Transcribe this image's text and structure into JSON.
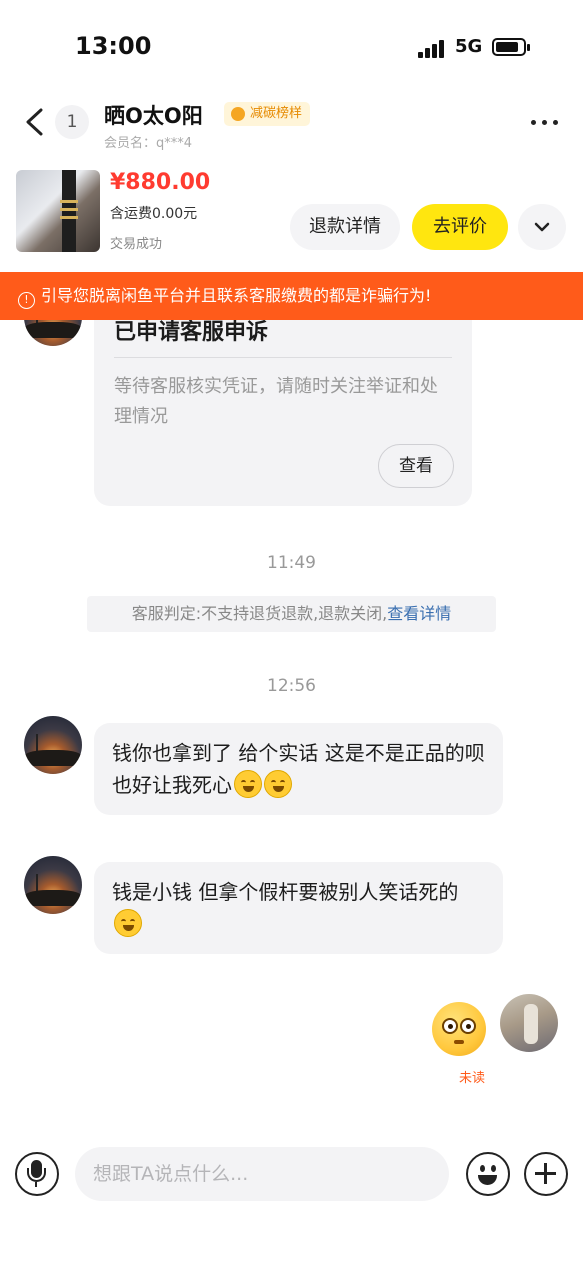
{
  "status_bar": {
    "time": "13:00",
    "network": "5G",
    "icons": [
      "signal-icon",
      "battery-icon"
    ]
  },
  "header": {
    "unread_count": "1",
    "seller_name": "晒O太O阳",
    "badge": "减碳榜样",
    "member_id": "会员名：q***4",
    "icons": [
      "back-arrow-icon",
      "more-icon",
      "leaf-icon"
    ]
  },
  "product": {
    "price": "¥880.00",
    "shipping": "含运费0.00元",
    "status": "交易成功",
    "refund_button": "退款详情",
    "review_button": "去评价",
    "expand_icon": "chevron-down-icon"
  },
  "warning": {
    "text": "引导您脱离闲鱼平台并且联系客服缴费的都是诈骗行为!",
    "icon": "alert-icon"
  },
  "messages": {
    "appeal_card": {
      "title": "已申请客服申诉",
      "body": "等待客服核实凭证，请随时关注举证和处理情况",
      "button": "查看"
    },
    "time1": "11:49",
    "system_note": {
      "text": "客服判定:不支持退货退款,退款关闭,",
      "link": "查看详情"
    },
    "time2": "12:56",
    "msg1": "钱你也拿到了 给个实话 这是不是正品的呗 也好让我死心",
    "msg2": "钱是小钱 但拿个假杆要被别人笑话死的",
    "my_status": "未读"
  },
  "input_bar": {
    "placeholder": "想跟TA说点什么...",
    "icons": [
      "microphone-icon",
      "emoji-icon",
      "plus-icon"
    ]
  },
  "colors": {
    "accent_yellow": "#ffe60f",
    "price_red": "#ff3b30",
    "warning_orange": "#ff5b1a",
    "link_blue": "#3a6fb0"
  }
}
